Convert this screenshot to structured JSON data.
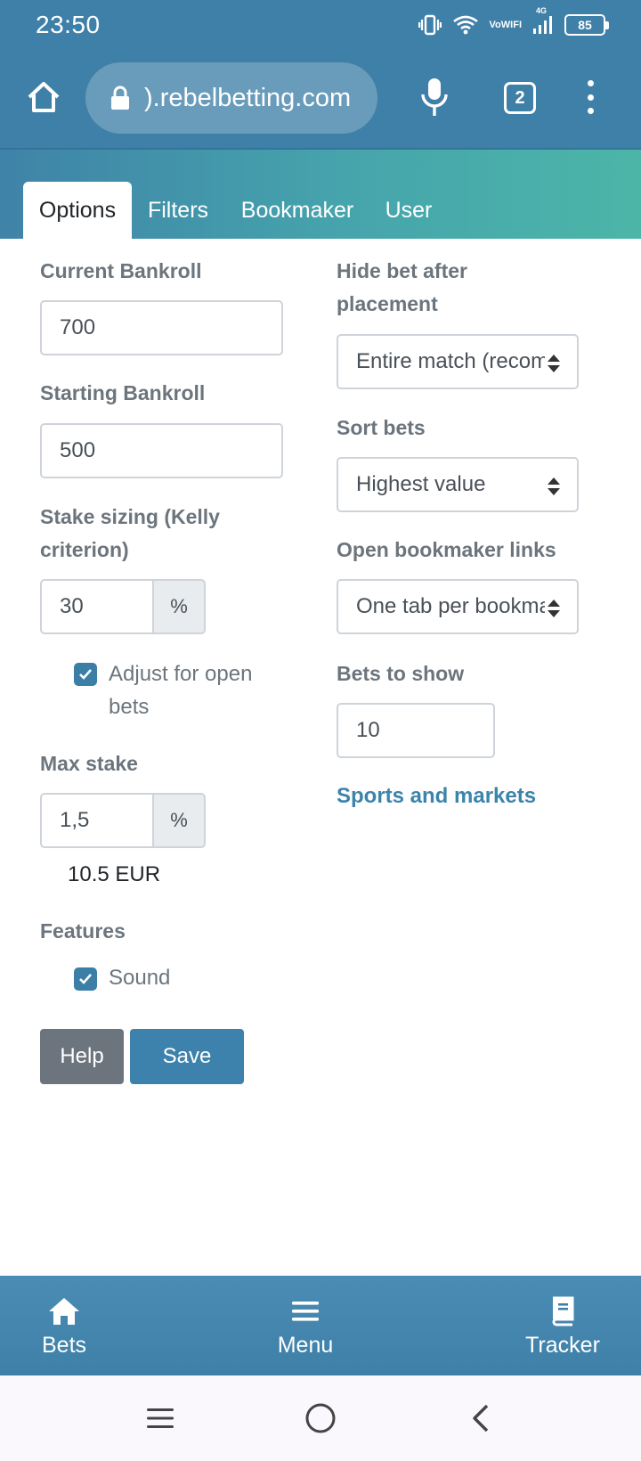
{
  "status_bar": {
    "time": "23:50",
    "network_top": "Vo",
    "network_bottom": "WIFI",
    "signal_label": "4G",
    "battery": "85"
  },
  "browser": {
    "url": ").rebelbetting.com",
    "tab_count": "2"
  },
  "tabs": [
    {
      "label": "Options",
      "active": true
    },
    {
      "label": "Filters",
      "active": false
    },
    {
      "label": "Bookmaker",
      "active": false
    },
    {
      "label": "User",
      "active": false
    }
  ],
  "form": {
    "current_bankroll": {
      "label": "Current Bankroll",
      "value": "700"
    },
    "starting_bankroll": {
      "label": "Starting Bankroll",
      "value": "500"
    },
    "stake_sizing": {
      "label_line1": "Stake sizing (Kelly",
      "label_line2": "criterion)",
      "value": "30",
      "unit": "%"
    },
    "adjust_open_bets": {
      "label_line1": "Adjust for open",
      "label_line2": "bets",
      "checked": true
    },
    "max_stake": {
      "label": "Max stake",
      "value": "1,5",
      "unit": "%",
      "computed": "10.5 EUR"
    },
    "features": {
      "label": "Features",
      "sound_label": "Sound",
      "sound_checked": true
    },
    "hide_bet": {
      "label_line1": "Hide bet after",
      "label_line2": "placement",
      "value": "Entire match (recommended)"
    },
    "sort_bets": {
      "label": "Sort bets",
      "value": "Highest value"
    },
    "open_links": {
      "label": "Open bookmaker links",
      "value": "One tab per bookmaker"
    },
    "bets_to_show": {
      "label": "Bets to show",
      "value": "10"
    },
    "sports_link": "Sports and markets"
  },
  "buttons": {
    "help": "Help",
    "save": "Save"
  },
  "app_nav": {
    "bets": "Bets",
    "menu": "Menu",
    "tracker": "Tracker"
  },
  "colors": {
    "primary": "#3f80a8",
    "teal": "#4cb5a8",
    "label_gray": "#6c757d",
    "link": "#3c84ab"
  }
}
